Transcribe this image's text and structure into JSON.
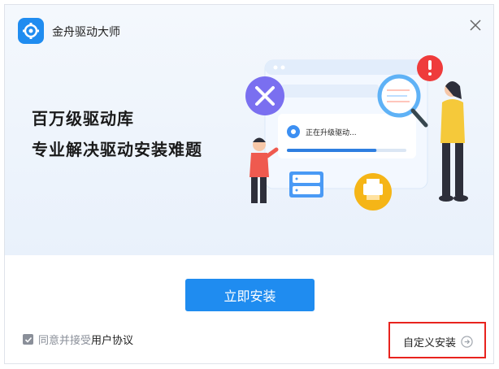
{
  "app": {
    "title": "金舟驱动大师"
  },
  "hero": {
    "slogan_line1": "百万级驱动库",
    "slogan_line2": "专业解决驱动安装难题"
  },
  "illustration": {
    "progress_text": "正在升级驱动...",
    "progress_fraction": 0.75
  },
  "actions": {
    "install_label": "立即安装",
    "custom_install_label": "自定义安装"
  },
  "agreement": {
    "checked": true,
    "text": "同意并接受",
    "link_text": "用户协议"
  },
  "colors": {
    "primary": "#1f8cf0",
    "highlight_border": "#e8231e",
    "alert": "#ef3b3b",
    "yellow": "#f5b517",
    "purple": "#7a6ff0"
  },
  "icons": {
    "logo": "gear-wrench-logo-icon",
    "close": "close-icon",
    "custom_arrow": "arrow-right-circle-icon",
    "check": "check-icon"
  }
}
